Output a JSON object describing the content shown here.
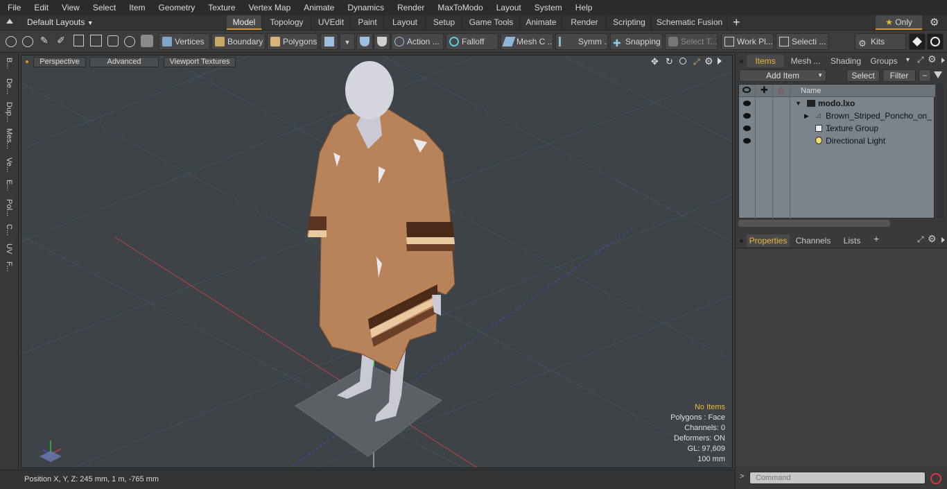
{
  "menu": [
    "File",
    "Edit",
    "View",
    "Select",
    "Item",
    "Geometry",
    "Texture",
    "Vertex Map",
    "Animate",
    "Dynamics",
    "Render",
    "MaxToModo",
    "Layout",
    "System",
    "Help"
  ],
  "layouts": {
    "default_label": "Default Layouts",
    "tabs": [
      "Model",
      "Topology",
      "UVEdit",
      "Paint",
      "Layout",
      "Setup",
      "Game Tools",
      "Animate",
      "Render",
      "Scripting",
      "Schematic Fusion"
    ],
    "active": "Model",
    "only_label": "Only"
  },
  "toolbar": {
    "vertices": "Vertices",
    "boundary": "Boundary",
    "polygons": "Polygons",
    "action": "Action",
    "falloff": "Falloff",
    "mesh_c": "Mesh C ...",
    "symm": "Symm ...",
    "snapping": "Snapping",
    "select_t": "Select T...",
    "work_pl": "Work Pl...",
    "selecti": "Selecti ...",
    "kits": "Kits"
  },
  "left_tabs": [
    "B...",
    "De...",
    "Dup...",
    "Mes...",
    "Ve...",
    "E...",
    "Pol...",
    "C...",
    "UV",
    "F..."
  ],
  "viewport": {
    "perspective": "Perspective",
    "advanced": "Advanced",
    "textures": "Viewport Textures",
    "hud": {
      "no_items": "No Items",
      "polygons": "Polygons : Face",
      "channels": "Channels: 0",
      "deformers": "Deformers: ON",
      "gl": "GL: 97,609",
      "scale": "100 mm"
    }
  },
  "status": {
    "position": "Position X, Y, Z:  245 mm, 1 m, -765 mm"
  },
  "items_panel": {
    "tabs": [
      "Items",
      "Mesh ...",
      "Shading",
      "Groups"
    ],
    "active": "Items",
    "add_item": "Add Item",
    "select": "Select",
    "filter": "Filter",
    "name_header": "Name",
    "rows": [
      "modo.lxo",
      "Brown_Striped_Poncho_on_ ...",
      "Texture Group",
      "Directional Light"
    ]
  },
  "props_panel": {
    "tabs": [
      "Properties",
      "Channels",
      "Lists"
    ],
    "active": "Properties"
  },
  "command": {
    "placeholder": "Command"
  },
  "colors": {
    "accent": "#e39a2b",
    "hud_highlight": "#f0b63c",
    "poncho": "#b9835a",
    "mannequin": "#c9cad6"
  }
}
